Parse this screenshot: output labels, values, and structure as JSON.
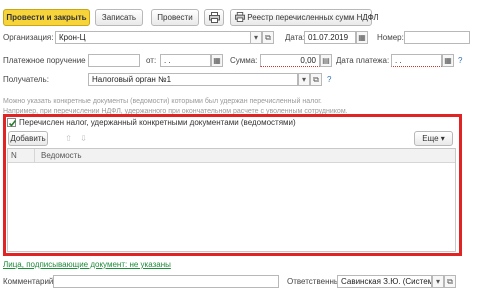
{
  "toolbar": {
    "post_and_close": "Провести и закрыть",
    "save": "Записать",
    "post": "Провести",
    "registry": "Реестр перечисленных сумм НДФЛ"
  },
  "form": {
    "organization_label": "Организация:",
    "organization_value": "Крон-Ц",
    "date_label": "Дата:",
    "date_value": "01.07.2019",
    "number_label": "Номер:",
    "number_value": "",
    "payment_order_label": "Платежное поручение №:",
    "payment_order_value": "",
    "from_label": "от:",
    "from_value": " .  .",
    "amount_label": "Сумма:",
    "amount_value": "0,00",
    "payment_date_label": "Дата платежа:",
    "payment_date_value": " .  .",
    "help": "?",
    "recipient_label": "Получатель:",
    "recipient_value": "Налоговый орган №1"
  },
  "hints": {
    "line1": "Можно указать конкретные документы (ведомости) которыми был удержан перечисленный налог.",
    "line2": "Например, при перечислении НДФЛ, удержанного при окончательном расчете с уволенным сотрудником."
  },
  "section": {
    "checkbox_label": "Перечислен налог, удержанный конкретными документами (ведомостями)",
    "checkbox_checked": true,
    "add_button": "Добавить",
    "more_button": "Еще",
    "columns": [
      "N",
      "Ведомость"
    ],
    "rows": []
  },
  "footer": {
    "signers_link": "Лица, подписывающие документ: не указаны",
    "comment_label": "Комментарий:",
    "comment_value": "",
    "responsible_label": "Ответственный:",
    "responsible_value": "Савинская З.Ю. (Системн"
  },
  "icons": {
    "print": "printer-icon",
    "registry": "printer-icon",
    "select": "ellipsis-icon",
    "open": "open-link-icon",
    "calendar": "calendar-icon",
    "calculator": "calculator-icon",
    "dropdown": "chevron-down-icon",
    "arrow_up": "arrow-up-icon",
    "arrow_down": "arrow-down-icon"
  },
  "colors": {
    "primary": "#f6d43a",
    "highlight_frame": "#e02424",
    "link": "#1f8b3b",
    "help": "#2f6eb5"
  }
}
